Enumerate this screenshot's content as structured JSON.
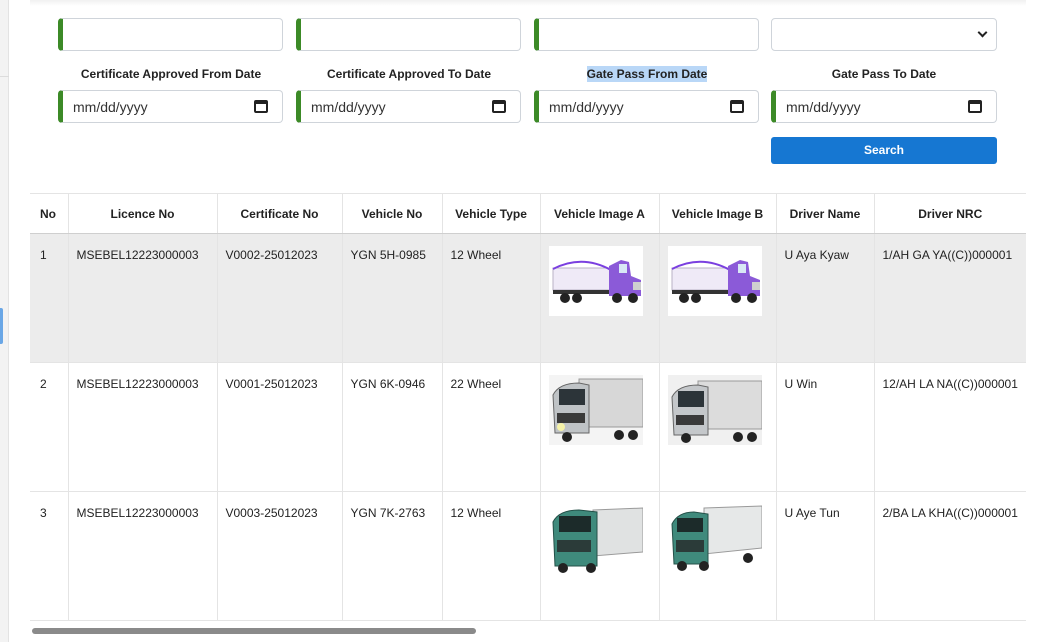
{
  "filters": {
    "row1": [
      {
        "value": ""
      },
      {
        "value": ""
      },
      {
        "value": ""
      }
    ],
    "select": {
      "value": ""
    },
    "labels": [
      "Certificate Approved From Date",
      "Certificate Approved To Date",
      "Gate Pass From Date",
      "Gate Pass To Date"
    ],
    "dates": [
      "mm/dd/yyyy",
      "mm/dd/yyyy",
      "mm/dd/yyyy",
      "mm/dd/yyyy"
    ],
    "search_label": "Search",
    "accent_color": "#3c8a27",
    "button_color": "#1677d2"
  },
  "table": {
    "columns": [
      "No",
      "Licence No",
      "Certificate No",
      "Vehicle No",
      "Vehicle Type",
      "Vehicle Image A",
      "Vehicle Image B",
      "Driver Name",
      "Driver NRC"
    ],
    "rows": [
      {
        "no": "1",
        "licence": "MSEBEL12223000003",
        "certificate": "V0002-25012023",
        "vehicle_no": "YGN 5H-0985",
        "vehicle_type": "12 Wheel",
        "image_a": "purple-semi-truck-image",
        "image_b": "purple-semi-truck-image",
        "driver": "U Aya Kyaw",
        "nrc": "1/AH GA YA((C))000001"
      },
      {
        "no": "2",
        "licence": "MSEBEL12223000003",
        "certificate": "V0001-25012023",
        "vehicle_no": "YGN 6K-0946",
        "vehicle_type": "22 Wheel",
        "image_a": "silver-box-truck-image",
        "image_b": "silver-box-truck-image",
        "driver": "U Win",
        "nrc": "12/AH LA NA((C))000001"
      },
      {
        "no": "3",
        "licence": "MSEBEL12223000003",
        "certificate": "V0003-25012023",
        "vehicle_no": "YGN 7K-2763",
        "vehicle_type": "12 Wheel",
        "image_a": "green-truck-image",
        "image_b": "green-truck-image",
        "driver": "U Aye Tun",
        "nrc": "2/BA LA KHA((C))000001"
      }
    ]
  }
}
